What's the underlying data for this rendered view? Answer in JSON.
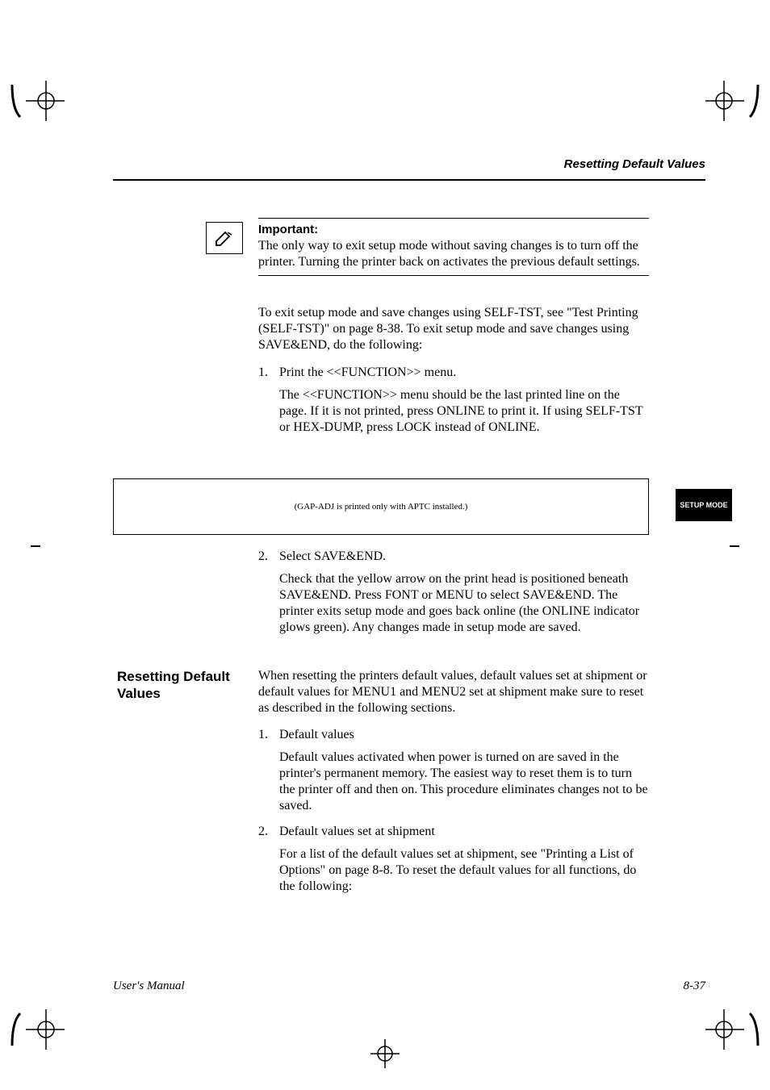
{
  "header": {
    "running_head": "Resetting Default Values"
  },
  "tab": {
    "label": "SETUP MODE"
  },
  "note": {
    "label": "Important:",
    "text": "The only way to exit setup mode without saving changes is to turn off the printer. Turning the printer back on activates the previous default settings."
  },
  "body": {
    "p1": "To exit setup mode and save changes using SELF-TST, see \"Test Printing (SELF-TST)\" on page 8-38. To exit setup mode and save changes using SAVE&END, do the following:",
    "step1_num": "1.",
    "step1": "Print the <<FUNCTION>> menu.",
    "step1_sub": "The <<FUNCTION>> menu should be the last printed line on the page. If it is not printed, press ONLINE to print it.   If using SELF-TST or HEX-DUMP, press LOCK instead of ONLINE.",
    "func_box": "(GAP-ADJ is printed only with APTC installed.)",
    "step2_num": "2.",
    "step2": "Select SAVE&END.",
    "step2_sub": "Check that the yellow arrow on the print head is positioned beneath SAVE&END. Press FONT or MENU to select SAVE&END. The printer exits setup mode and goes back online (the ONLINE indicator glows green). Any changes made in setup mode are saved."
  },
  "section2": {
    "heading": "Resetting Default Values",
    "p1": "When resetting the printers default values, default values set at shipment or default values for MENU1 and MENU2 set at shipment make sure to reset as described in the following sections.",
    "item1_num": "1.",
    "item1": "Default values",
    "item1_sub": "Default values activated when power is turned on are saved in the printer's permanent memory. The easiest way to reset them is to turn the printer off and then on. This procedure eliminates changes not to be saved.",
    "item2_num": "2.",
    "item2": "Default values set at shipment",
    "item2_sub": "For a list of the default values set at shipment, see \"Printing a List of Options\" on page 8-8. To reset the default values for all functions, do the following:"
  },
  "footer": {
    "left": "User's Manual",
    "right": "8-37"
  }
}
